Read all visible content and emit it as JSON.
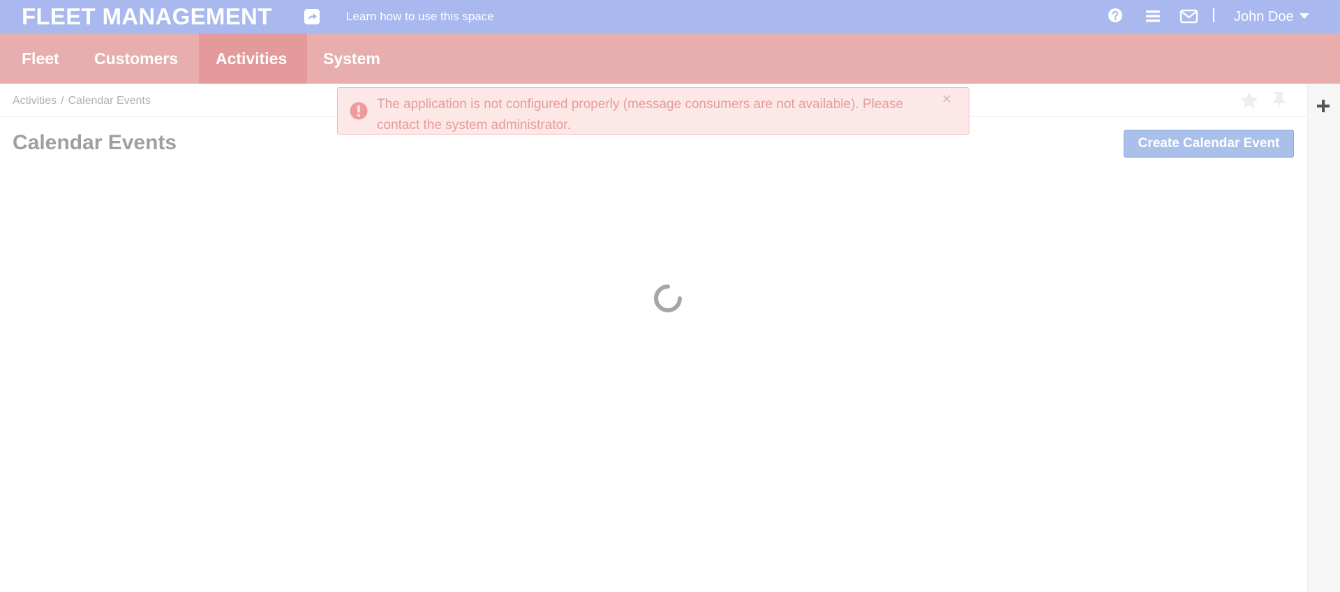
{
  "app": {
    "title": "FLEET MANAGEMENT",
    "learn_link": "Learn how to use this space",
    "user_name": "John Doe"
  },
  "nav": {
    "items": [
      {
        "label": "Fleet"
      },
      {
        "label": "Customers"
      },
      {
        "label": "Activities"
      },
      {
        "label": "System"
      }
    ],
    "active": "Activities"
  },
  "breadcrumb": {
    "parent": "Activities",
    "separator": "/",
    "current": "Calendar Events"
  },
  "page": {
    "title": "Calendar Events",
    "create_button": "Create Calendar Event"
  },
  "alert": {
    "message": "The application is not configured properly (message consumers are not available). Please contact the system administrator.",
    "close_symbol": "×"
  },
  "icons": {
    "share": "share-icon",
    "help": "help-icon",
    "menu": "list-menu-icon",
    "mail": "envelope-icon",
    "favorite": "star-icon",
    "pin": "pin-icon",
    "add": "plus-icon",
    "alert": "exclamation-circle-icon",
    "loading": "loading-spinner-icon"
  },
  "colors": {
    "topbar": "#a9b8ef",
    "nav": "#e8aeae",
    "nav_active": "#e49a9a",
    "alert_bg": "#fde8e8",
    "alert_text": "#e79b9b",
    "primary_button": "#a9c0ea"
  }
}
